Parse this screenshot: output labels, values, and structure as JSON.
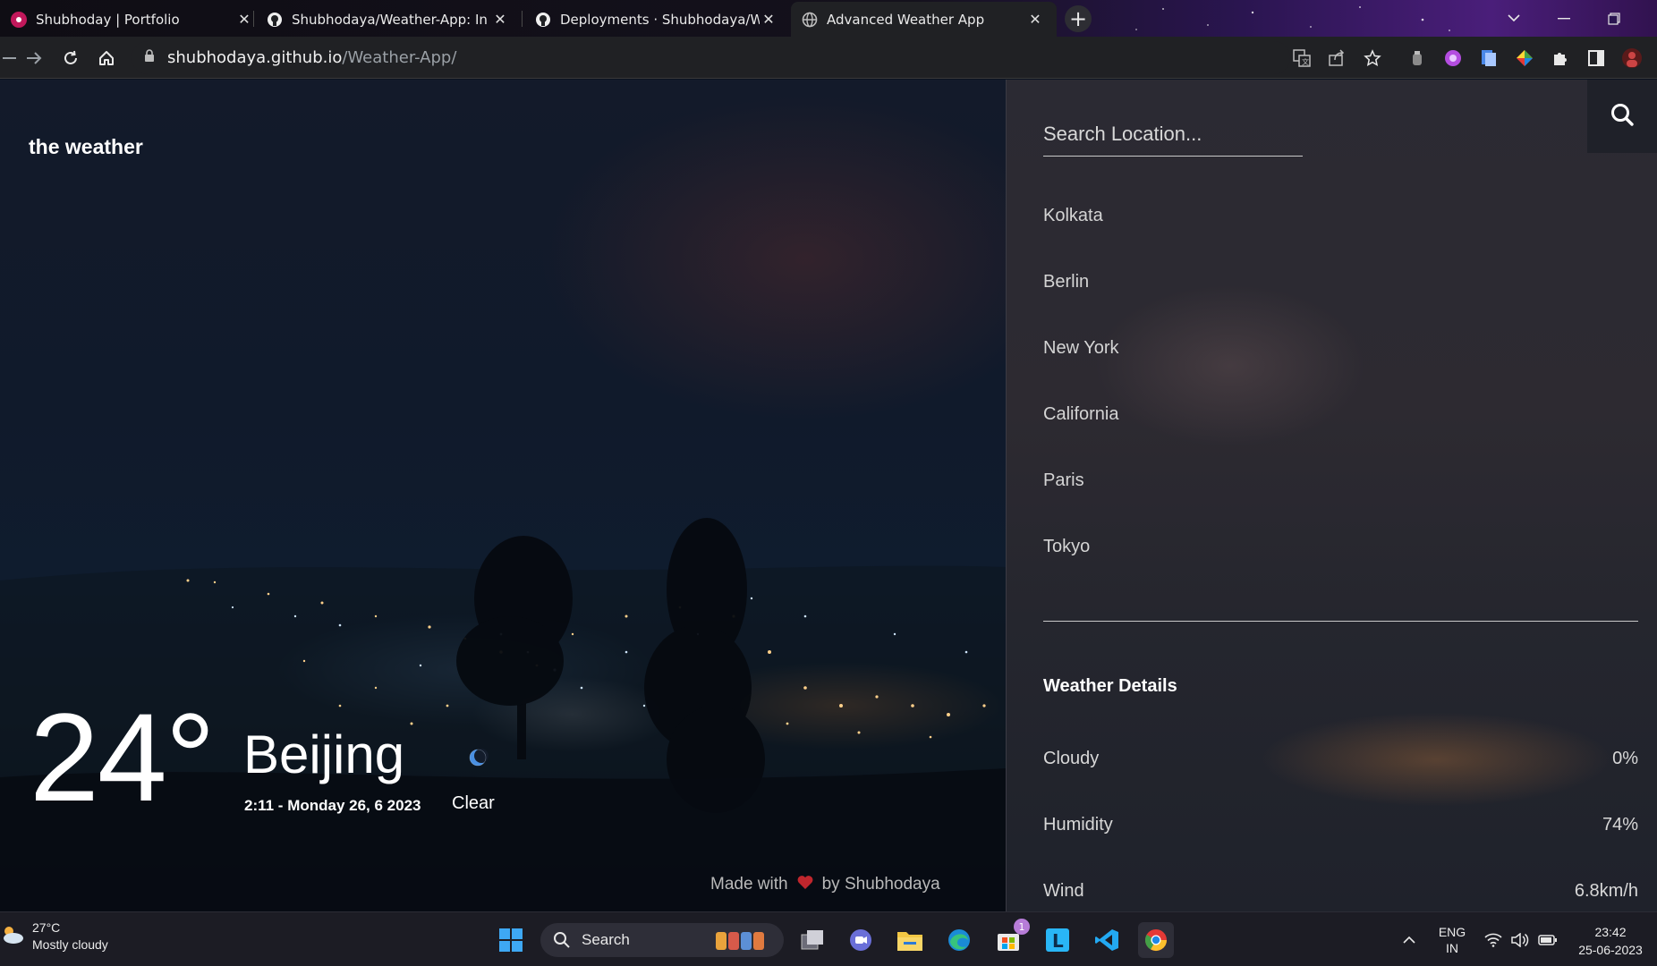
{
  "browser": {
    "tabs": [
      {
        "title": "Shubhoday | Portfolio",
        "icon": "portfolio-favicon",
        "active": false
      },
      {
        "title": "Shubhodaya/Weather-App: In thi",
        "icon": "github-icon",
        "active": false
      },
      {
        "title": "Deployments · Shubhodaya/Wea",
        "icon": "github-icon",
        "active": false
      },
      {
        "title": "Advanced Weather App",
        "icon": "globe-icon",
        "active": true
      }
    ],
    "url_host": "shubhodaya.github.io",
    "url_path": "/Weather-App/"
  },
  "app": {
    "brand": "the weather",
    "temperature": "24°",
    "city": "Beijing",
    "datetime": "2:11 - Monday 26, 6 2023",
    "condition": "Clear",
    "condition_icon": "moon-icon",
    "footer_made_with": "Made with",
    "footer_by": "by Shubhodaya"
  },
  "panel": {
    "search_placeholder": "Search Location...",
    "cities": [
      "Kolkata",
      "Berlin",
      "New York",
      "California",
      "Paris",
      "Tokyo"
    ],
    "details_title": "Weather Details",
    "details": [
      {
        "label": "Cloudy",
        "value": "0%"
      },
      {
        "label": "Humidity",
        "value": "74%"
      },
      {
        "label": "Wind",
        "value": "6.8km/h"
      }
    ]
  },
  "taskbar": {
    "weather_temp": "27°C",
    "weather_desc": "Mostly cloudy",
    "search_label": "Search",
    "store_badge": "1",
    "lang_top": "ENG",
    "lang_bottom": "IN",
    "time": "23:42",
    "date": "25-06-2023"
  },
  "colors": {
    "accent_white": "#ffffff",
    "panel_bg": "#2b2a33",
    "heart": "#c0262d",
    "moon": "#4a90e2"
  }
}
